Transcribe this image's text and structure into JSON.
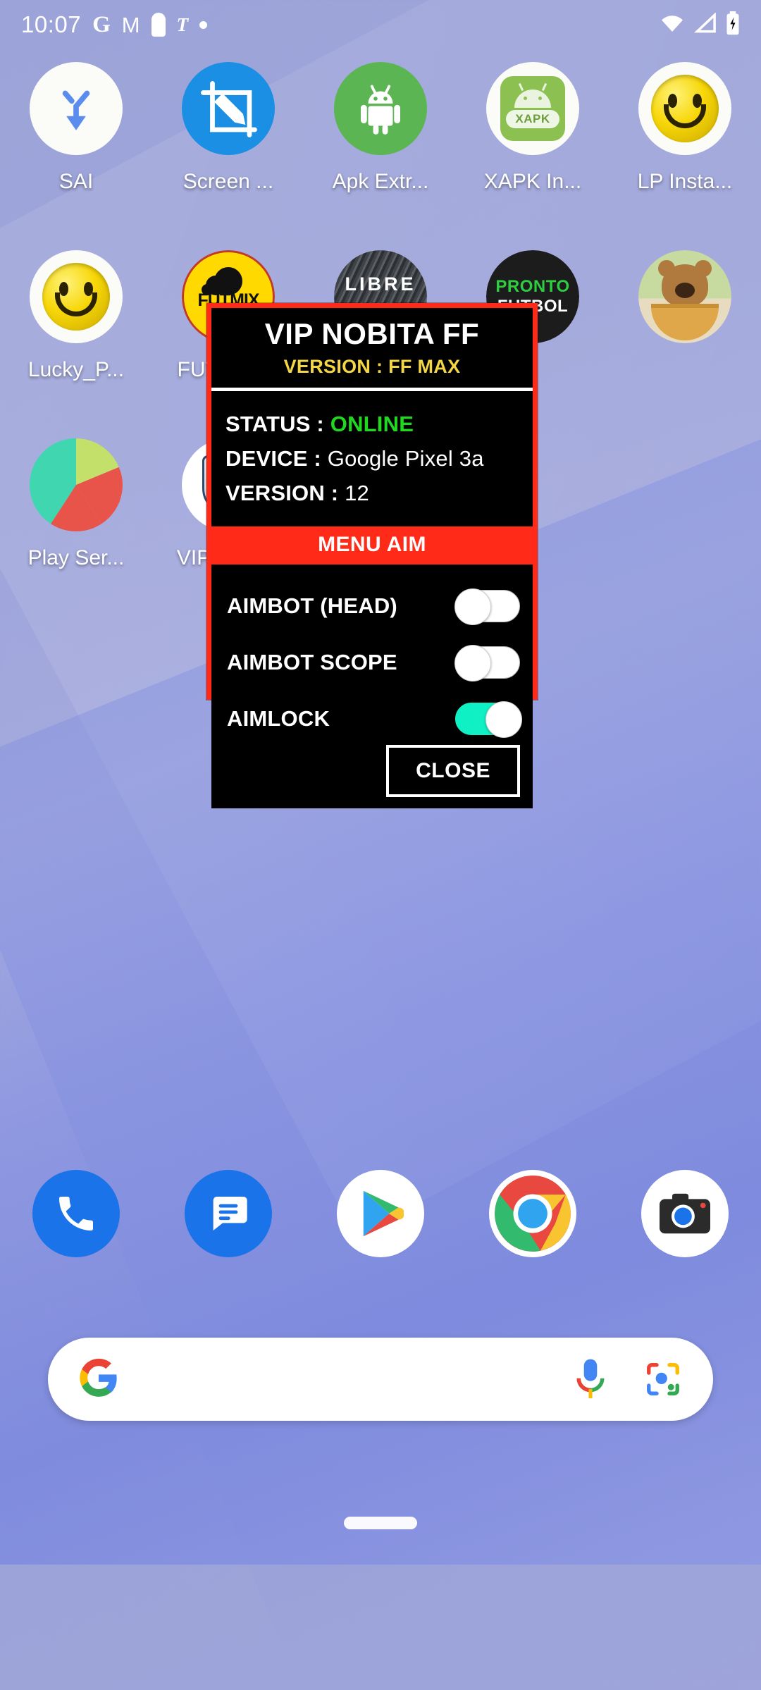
{
  "status_bar": {
    "time": "10:07",
    "left_icons": [
      "google-icon",
      "gmail-icon",
      "keyhole-icon",
      "t-icon",
      "dot-icon"
    ],
    "right_icons": [
      "wifi-icon",
      "signal-icon",
      "battery-charging-icon"
    ]
  },
  "home_screen": {
    "rows": [
      [
        {
          "label": "SAI",
          "icon": "sai-icon"
        },
        {
          "label": "Screen ...",
          "icon": "screenshot-editor-icon"
        },
        {
          "label": "Apk Extr...",
          "icon": "apk-extractor-icon"
        },
        {
          "label": "XAPK In...",
          "icon": "xapk-installer-icon"
        },
        {
          "label": "LP  Insta...",
          "icon": "lucky-patcher-icon"
        }
      ],
      [
        {
          "label": "Lucky_P...",
          "icon": "lucky-patcher-icon"
        },
        {
          "label": "FUTMIX ...",
          "icon": "futmix-live-icon"
        },
        {
          "label": "",
          "icon": "libre-vip-icon"
        },
        {
          "label": "",
          "icon": "pronto-futbol-icon"
        },
        {
          "label": "",
          "icon": "bear-app-icon"
        }
      ],
      [
        {
          "label": "Play Ser...",
          "icon": "play-services-icon"
        },
        {
          "label": "VIP NOB...",
          "icon": "vip-nobita-icon"
        }
      ]
    ]
  },
  "overlay": {
    "title": "VIP NOBITA FF",
    "subtitle": "VERSION : FF MAX",
    "info": [
      {
        "key": "STATUS :",
        "value": "ONLINE",
        "value_color": "#1fd81f"
      },
      {
        "key": "DEVICE :",
        "value": "Google Pixel 3a",
        "value_color": "#ffffff"
      },
      {
        "key": "VERSION :",
        "value": "12",
        "value_color": "#ffffff"
      }
    ],
    "section_title": "MENU AIM",
    "toggles": [
      {
        "label": "AIMBOT (HEAD)",
        "state": "off"
      },
      {
        "label": "AIMBOT SCOPE",
        "state": "off"
      },
      {
        "label": "AIMLOCK",
        "state": "on"
      }
    ],
    "close_label": "CLOSE",
    "colors": {
      "border": "#ff2a17",
      "background": "#000000",
      "accent_yellow": "#f4d642",
      "accent_green": "#1fd81f",
      "toggle_on": "#0ff0c4"
    }
  },
  "dock": {
    "items": [
      {
        "name": "phone",
        "icon": "phone-icon"
      },
      {
        "name": "messages",
        "icon": "messages-icon"
      },
      {
        "name": "play-store",
        "icon": "play-store-icon"
      },
      {
        "name": "chrome",
        "icon": "chrome-icon"
      },
      {
        "name": "camera",
        "icon": "camera-icon"
      }
    ]
  },
  "search": {
    "placeholder": "",
    "value": "",
    "icons": [
      "google-g-icon",
      "microphone-icon",
      "google-lens-icon"
    ]
  }
}
